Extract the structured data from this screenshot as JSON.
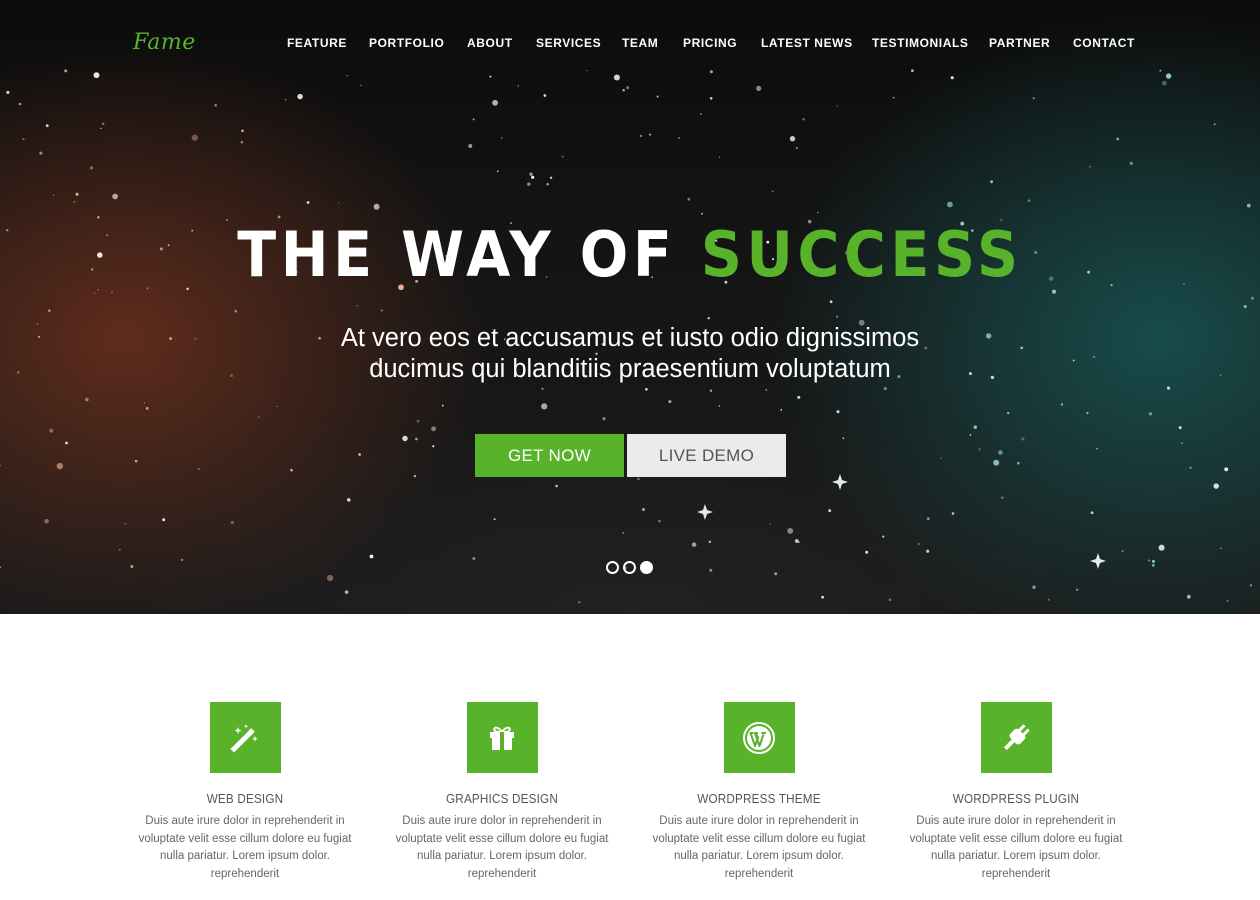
{
  "brand": {
    "logo": "Fame",
    "accent_color": "#59b32a"
  },
  "nav": {
    "items": [
      {
        "label": "FEATURE"
      },
      {
        "label": "PORTFOLIO"
      },
      {
        "label": "ABOUT"
      },
      {
        "label": "SERVICES"
      },
      {
        "label": "TEAM"
      },
      {
        "label": "PRICING"
      },
      {
        "label": "LATEST NEWS"
      },
      {
        "label": "TESTIMONIALS"
      },
      {
        "label": "PARTNER"
      },
      {
        "label": "CONTACT"
      }
    ]
  },
  "hero": {
    "headline_main": "THE WAY OF ",
    "headline_accent": "SUCCESS",
    "subtitle_line1": "At vero eos et accusamus et iusto odio dignissimos",
    "subtitle_line2": "ducimus qui blanditiis praesentium voluptatum",
    "primary_button": "GET NOW",
    "secondary_button": "LIVE DEMO",
    "slider": {
      "total": 3,
      "active": 3
    }
  },
  "features": [
    {
      "icon": "magic-wand-icon",
      "title": "WEB DESIGN",
      "text": "Duis aute irure dolor in reprehenderit in voluptate velit esse cillum dolore eu fugiat nulla pariatur. Lorem ipsum dolor. reprehenderit"
    },
    {
      "icon": "gift-icon",
      "title": "GRAPHICS DESIGN",
      "text": "Duis aute irure dolor in reprehenderit in voluptate velit esse cillum dolore eu fugiat nulla pariatur. Lorem ipsum dolor. reprehenderit"
    },
    {
      "icon": "wordpress-icon",
      "title": "WORDPRESS THEME",
      "text": "Duis aute irure dolor in reprehenderit in voluptate velit esse cillum dolore eu fugiat nulla pariatur. Lorem ipsum dolor. reprehenderit"
    },
    {
      "icon": "plug-icon",
      "title": "WORDPRESS PLUGIN",
      "text": "Duis aute irure dolor in reprehenderit in voluptate velit esse cillum dolore eu fugiat nulla pariatur. Lorem ipsum dolor. reprehenderit"
    }
  ]
}
